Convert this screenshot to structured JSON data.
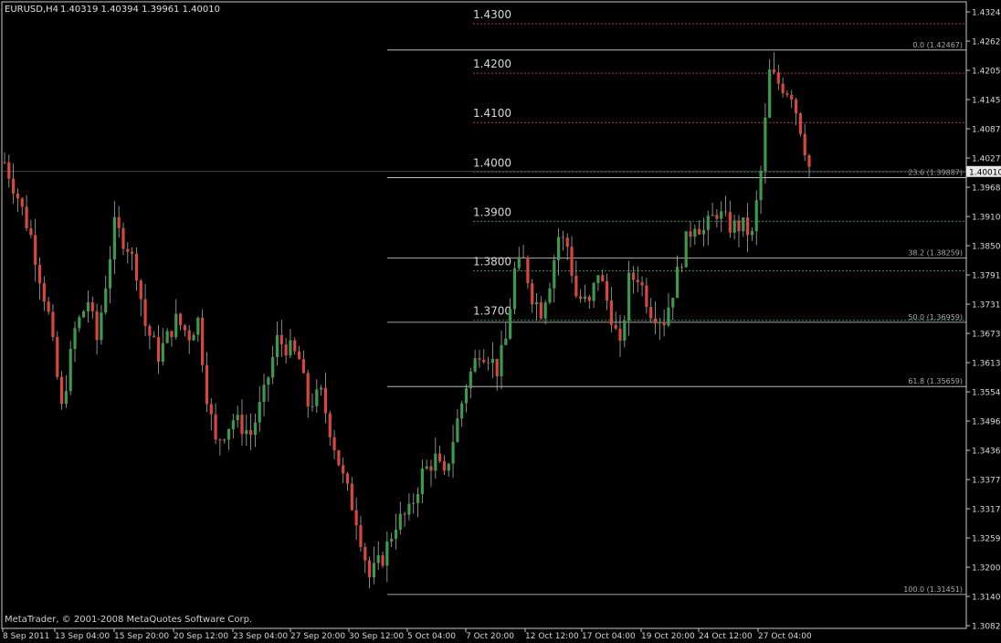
{
  "header": {
    "symbol_text": "EURUSD,H4",
    "ohlc_text": "1.40319 1.40394 1.39961 1.40010"
  },
  "footer": {
    "copyright": "MetaTrader, © 2001-2008 MetaQuotes Software Corp."
  },
  "colors": {
    "background": "#000000",
    "bull": "#3c9a4c",
    "bear": "#d9463c",
    "wick": "#aaaaaa",
    "axis": "#c8c8c8",
    "fib": "#d8d8d8",
    "dotted_red": "#c0392b",
    "dotted_green": "#2e8b3c",
    "price_line": "#5a5a5a"
  },
  "chart_data": {
    "type": "candlestick",
    "ylim": [
      1.3082,
      1.4324
    ],
    "y_ticks": [
      "1.43240",
      "1.42620",
      "1.42055",
      "1.41450",
      "1.40870",
      "1.40270",
      "1.39685",
      "1.39100",
      "1.38505",
      "1.37915",
      "1.37315",
      "1.36730",
      "1.36130",
      "1.35545",
      "1.34960",
      "1.34360",
      "1.33775",
      "1.33175",
      "1.32590",
      "1.32005",
      "1.31405",
      "1.30820"
    ],
    "x_ticks": [
      "8 Sep 2011",
      "13 Sep 04:00",
      "15 Sep 20:00",
      "20 Sep 12:00",
      "23 Sep 04:00",
      "27 Sep 20:00",
      "30 Sep 12:00",
      "5 Oct 04:00",
      "7 Oct 20:00",
      "12 Oct 12:00",
      "17 Oct 04:00",
      "19 Oct 20:00",
      "24 Oct 12:00",
      "27 Oct 04:00"
    ],
    "current_price": "1.40010",
    "round_levels": [
      {
        "label": "1.4300",
        "value": 1.43,
        "style": "red"
      },
      {
        "label": "1.4200",
        "value": 1.42,
        "style": "red"
      },
      {
        "label": "1.4100",
        "value": 1.41,
        "style": "red"
      },
      {
        "label": "1.4000",
        "value": 1.4,
        "style": "green"
      },
      {
        "label": "1.3900",
        "value": 1.39,
        "style": "green"
      },
      {
        "label": "1.3800",
        "value": 1.38,
        "style": "green"
      },
      {
        "label": "1.3700",
        "value": 1.37,
        "style": "green"
      }
    ],
    "fibonacci": [
      {
        "label": "0.0 (1.42467)",
        "value": 1.42467
      },
      {
        "label": "23.6 (1.39887)",
        "value": 1.39887
      },
      {
        "label": "38.2 (1.38259)",
        "value": 1.38259
      },
      {
        "label": "50.0 (1.36959)",
        "value": 1.36959
      },
      {
        "label": "61.8 (1.35659)",
        "value": 1.35659
      },
      {
        "label": "100.0 (1.31451)",
        "value": 1.31451
      }
    ],
    "path": [
      [
        0,
        1.402
      ],
      [
        3,
        1.395
      ],
      [
        6,
        1.387
      ],
      [
        10,
        1.371
      ],
      [
        13,
        1.352
      ],
      [
        16,
        1.368
      ],
      [
        19,
        1.374
      ],
      [
        21,
        1.366
      ],
      [
        25,
        1.389
      ],
      [
        28,
        1.385
      ],
      [
        30,
        1.38
      ],
      [
        32,
        1.369
      ],
      [
        35,
        1.363
      ],
      [
        39,
        1.37
      ],
      [
        42,
        1.367
      ],
      [
        44,
        1.37
      ],
      [
        46,
        1.355
      ],
      [
        48,
        1.345
      ],
      [
        52,
        1.35
      ],
      [
        56,
        1.347
      ],
      [
        59,
        1.355
      ],
      [
        62,
        1.366
      ],
      [
        65,
        1.364
      ],
      [
        67,
        1.362
      ],
      [
        69,
        1.353
      ],
      [
        72,
        1.355
      ],
      [
        74,
        1.348
      ],
      [
        77,
        1.338
      ],
      [
        80,
        1.33
      ],
      [
        83,
        1.318
      ],
      [
        86,
        1.322
      ],
      [
        89,
        1.329
      ],
      [
        92,
        1.331
      ],
      [
        95,
        1.339
      ],
      [
        98,
        1.342
      ],
      [
        100,
        1.338
      ],
      [
        102,
        1.346
      ],
      [
        105,
        1.357
      ],
      [
        108,
        1.364
      ],
      [
        110,
        1.363
      ],
      [
        112,
        1.36
      ],
      [
        114,
        1.366
      ],
      [
        116,
        1.38
      ],
      [
        118,
        1.382
      ],
      [
        120,
        1.375
      ],
      [
        122,
        1.372
      ],
      [
        124,
        1.378
      ],
      [
        126,
        1.387
      ],
      [
        128,
        1.385
      ],
      [
        130,
        1.375
      ],
      [
        133,
        1.373
      ],
      [
        135,
        1.38
      ],
      [
        138,
        1.371
      ],
      [
        140,
        1.364
      ],
      [
        142,
        1.378
      ],
      [
        144,
        1.379
      ],
      [
        147,
        1.372
      ],
      [
        150,
        1.37
      ],
      [
        152,
        1.376
      ],
      [
        155,
        1.386
      ],
      [
        157,
        1.39
      ],
      [
        159,
        1.388
      ],
      [
        162,
        1.392
      ],
      [
        165,
        1.389
      ],
      [
        168,
        1.389
      ],
      [
        170,
        1.387
      ],
      [
        172,
        1.4
      ],
      [
        174,
        1.42
      ],
      [
        176,
        1.418
      ],
      [
        179,
        1.416
      ],
      [
        181,
        1.409
      ],
      [
        183,
        1.401
      ]
    ]
  }
}
